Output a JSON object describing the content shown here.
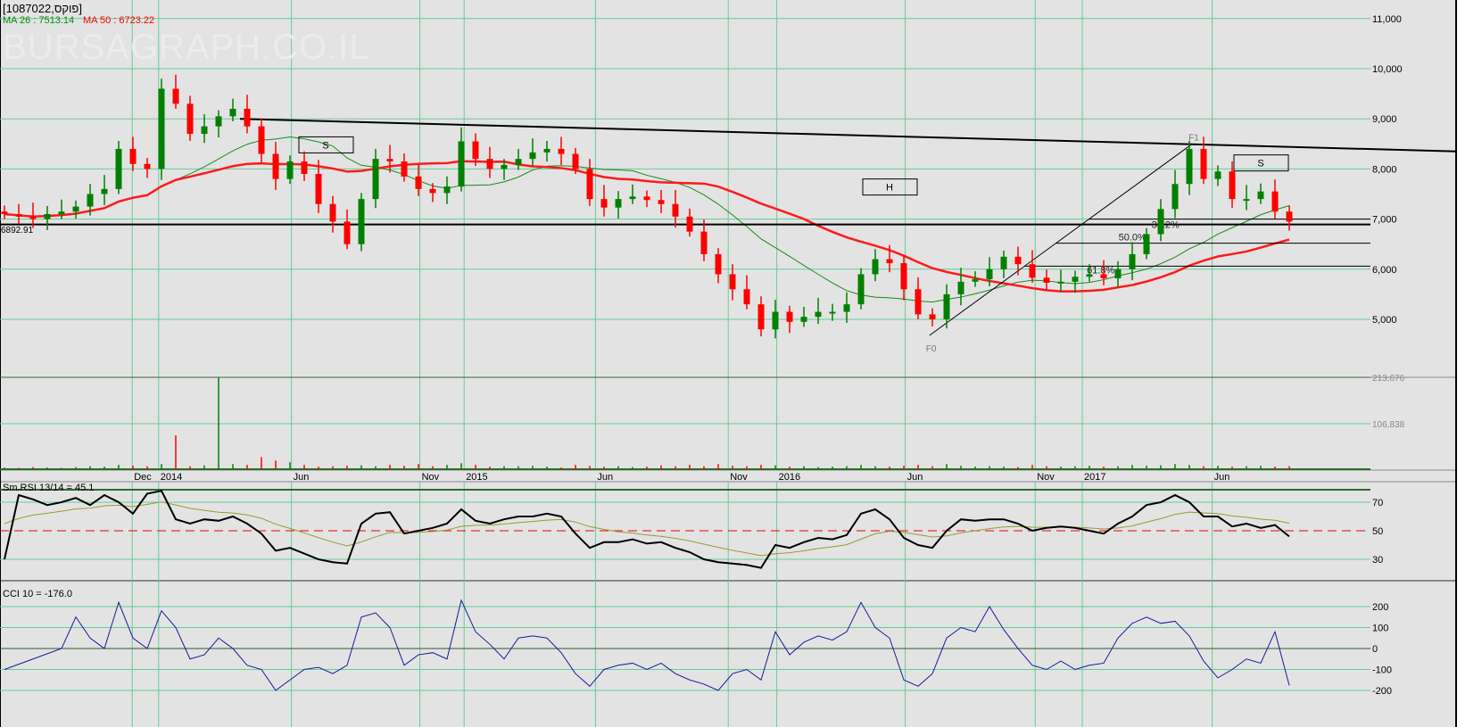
{
  "header": {
    "title": "[1087022,פוקס]",
    "ma26_label": "MA 26 : 7513.14",
    "ma50_label": "MA 50 : 6723.22",
    "watermark": "BURSAGRAPH.CO.IL",
    "support_label": "6892.91"
  },
  "colors": {
    "up": "#008000",
    "down": "#ff0000",
    "ma26": "#1a8a1a",
    "ma50": "#ff1a1a",
    "grid": "#66cc99",
    "rsi": "#000000",
    "rsi_signal": "#999933",
    "cci": "#1a1a99"
  },
  "chart_data": [
    {
      "type": "candlestick",
      "title": "[1087022,פוקס]",
      "y_ticks": [
        5000,
        6000,
        7000,
        8000,
        9000,
        10000,
        11000
      ],
      "y_tick_labels": [
        "5,000",
        "6,000",
        "7,000",
        "8,000",
        "9,000",
        "10,000",
        "11,000"
      ],
      "x_tick_labels": [
        "Dec",
        "2014",
        "Jun",
        "Nov",
        "2015",
        "Jun",
        "Nov",
        "2016",
        "Jun",
        "Nov",
        "2017",
        "Jun"
      ],
      "x_tick_index": [
        8.95,
        10.8,
        20.1,
        29.1,
        32.2,
        41.4,
        50.7,
        54.1,
        63.1,
        72.2,
        75.5,
        84.6
      ],
      "closes": [
        7100,
        7050,
        7000,
        7100,
        7150,
        7250,
        7500,
        7600,
        8400,
        8100,
        8000,
        9600,
        9300,
        8700,
        8850,
        9050,
        9200,
        8850,
        8300,
        7800,
        8150,
        7900,
        7300,
        6950,
        6500,
        7400,
        8200,
        8150,
        7850,
        7600,
        7520,
        7650,
        8550,
        8200,
        8000,
        8080,
        8200,
        8330,
        8400,
        8300,
        8000,
        7400,
        7230,
        7400,
        7450,
        7380,
        7300,
        7050,
        6750,
        6300,
        5900,
        5600,
        5300,
        4800,
        5150,
        4950,
        5050,
        5150,
        5150,
        5300,
        5900,
        6200,
        6120,
        5600,
        5100,
        5000,
        5500,
        5750,
        5800,
        6000,
        6250,
        6100,
        5830,
        5730,
        5750,
        5850,
        5900,
        5820,
        6000,
        6300,
        6700,
        7200,
        7700,
        8400,
        7800,
        7950,
        7400,
        7400,
        7550,
        7150,
        6950
      ],
      "ma_periods": [
        26,
        50
      ],
      "support_level": 6892.91,
      "trendline": {
        "start_index": 16.5,
        "start_price": 9000,
        "end_index": 102,
        "end_price": 8350
      },
      "fib": {
        "f0_index": 64.8,
        "f0_price": 4680,
        "f1_index": 83.2,
        "f1_price": 8500,
        "f0_label": "F0",
        "f1_label": "F1",
        "levels": [
          {
            "label": "38.2%",
            "price": 7000
          },
          {
            "label": "50.0%",
            "price": 6520
          },
          {
            "label": "61.8%",
            "price": 6060
          }
        ]
      },
      "boxes": [
        {
          "label": "S",
          "index": 22.5,
          "price": 8480
        },
        {
          "label": "H",
          "index": 62,
          "price": 7640
        },
        {
          "label": "S",
          "index": 88,
          "price": 8120
        }
      ]
    },
    {
      "type": "bar",
      "title": "Volume",
      "y_tick_labels": [
        "213,676",
        "106,838"
      ],
      "y_ticks": [
        213676,
        106838
      ],
      "values": [
        6000,
        5000,
        7000,
        6000,
        5000,
        7000,
        9000,
        8000,
        12000,
        10000,
        9000,
        14000,
        80000,
        9000,
        11000,
        213676,
        14000,
        12000,
        30000,
        22000,
        18000,
        12000,
        8000,
        9000,
        10000,
        11000,
        9000,
        12000,
        10000,
        14000,
        9000,
        12000,
        16000,
        12000,
        8000,
        9000,
        9000,
        10000,
        8000,
        6000,
        12000,
        10000,
        8000,
        9000,
        7000,
        8000,
        11000,
        9000,
        12000,
        9000,
        14000,
        10000,
        9000,
        12000,
        11000,
        8000,
        9000,
        7000,
        8000,
        9000,
        12000,
        9000,
        8000,
        10000,
        12000,
        9000,
        14000,
        10000,
        8000,
        9000,
        8000,
        7000,
        12000,
        9000,
        8000,
        9000,
        10000,
        8000,
        9000,
        12000,
        10000,
        11000,
        14000,
        12000,
        9000,
        10000,
        8000,
        9000,
        10000,
        8000,
        9000
      ]
    },
    {
      "type": "line",
      "title": "Sm.RSI 13/14 = 45.1",
      "y_ticks": [
        30,
        50,
        70
      ],
      "y_tick_labels": [
        "30",
        "50",
        "70"
      ],
      "values": [
        30,
        75,
        72,
        68,
        70,
        73,
        68,
        75,
        70,
        62,
        76,
        78,
        58,
        55,
        58,
        57,
        60,
        55,
        48,
        36,
        38,
        34,
        30,
        28,
        27,
        55,
        62,
        63,
        48,
        50,
        52,
        55,
        65,
        57,
        55,
        58,
        60,
        60,
        62,
        60,
        48,
        38,
        42,
        42,
        44,
        41,
        42,
        38,
        35,
        30,
        28,
        27,
        26,
        24,
        40,
        38,
        42,
        45,
        44,
        47,
        62,
        65,
        58,
        45,
        40,
        38,
        50,
        58,
        57,
        58,
        58,
        55,
        50,
        52,
        53,
        52,
        50,
        48,
        55,
        60,
        68,
        70,
        75,
        70,
        60,
        60,
        53,
        55,
        52,
        54,
        46
      ]
    },
    {
      "type": "line",
      "title": "CCI 10 = -176.0",
      "y_ticks": [
        200,
        100,
        0,
        -100,
        -200
      ],
      "y_tick_labels": [
        "200",
        "100",
        "0",
        "-100",
        "-200"
      ],
      "values": [
        -100,
        -75,
        -50,
        -25,
        0,
        150,
        50,
        0,
        220,
        50,
        0,
        180,
        100,
        -50,
        -30,
        50,
        0,
        -80,
        -100,
        -200,
        -150,
        -100,
        -90,
        -120,
        -80,
        150,
        170,
        100,
        -80,
        -30,
        -20,
        -50,
        230,
        80,
        20,
        -50,
        50,
        60,
        50,
        -20,
        -120,
        -180,
        -100,
        -80,
        -70,
        -100,
        -70,
        -120,
        -150,
        -170,
        -200,
        -120,
        -100,
        -150,
        80,
        -30,
        30,
        60,
        40,
        80,
        220,
        100,
        50,
        -150,
        -180,
        -120,
        50,
        100,
        80,
        200,
        90,
        0,
        -80,
        -100,
        -60,
        -100,
        -80,
        -70,
        50,
        120,
        150,
        120,
        130,
        60,
        -60,
        -140,
        -100,
        -50,
        -70,
        80,
        -176
      ]
    }
  ]
}
